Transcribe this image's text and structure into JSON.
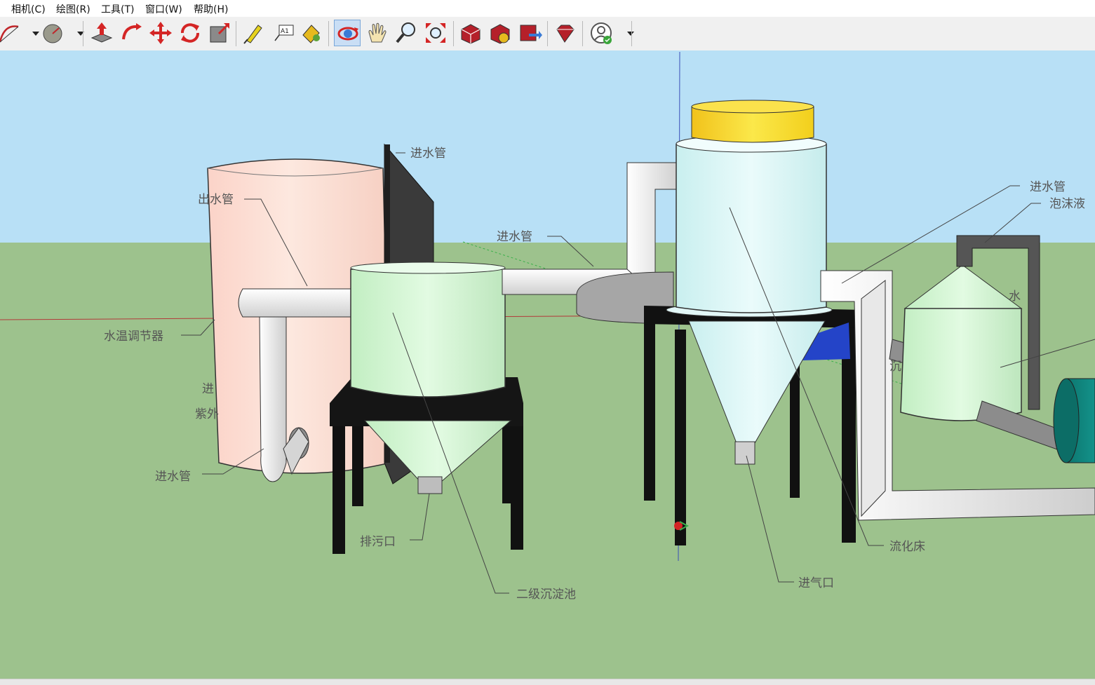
{
  "menu": [
    "相机(C)",
    "绘图(R)",
    "工具(T)",
    "窗口(W)",
    "帮助(H)"
  ],
  "toolbar": {
    "tools": [
      "arc-tool",
      "protractor-tool",
      "push-pull-tool",
      "follow-me-tool",
      "move-tool",
      "rotate-tool",
      "scale-tool",
      "tape-measure-tool",
      "text-tool",
      "paint-bucket-tool",
      "orbit-tool",
      "pan-tool",
      "zoom-tool",
      "zoom-extents-tool",
      "3d-warehouse-tool",
      "extension-warehouse-tool",
      "share-model-tool",
      "ruby-tool",
      "account-tool"
    ],
    "text_tool_glyph": "A1",
    "active_tool": "orbit-tool"
  },
  "colors": {
    "sky": "#b8e0f6",
    "ground": "#9dc28d",
    "tank_pink": "#fde3da",
    "tank_green": "#d4f7d4",
    "tower_cyan": "#dff6f6",
    "lid_yellow": "#f7d51c",
    "blower_teal": "#0d7a72",
    "frame": "#111111"
  },
  "labels": {
    "inlet_top": "进水管",
    "outlet": "出水管",
    "inlet_mid": "进水管",
    "temp_regulator": "水温调节器",
    "partial_inlet": "进",
    "partial_uv": "紫外",
    "inlet_bottom": "进水管",
    "sludge_outlet": "排污口",
    "secondary_settler": "二级沉淀池",
    "air_inlet": "进气口",
    "fluidized_bed": "流化床",
    "inlet_right": "进水管",
    "foam_partial": "泡沫液",
    "partial_water": "水",
    "partial_cut": "沉"
  }
}
